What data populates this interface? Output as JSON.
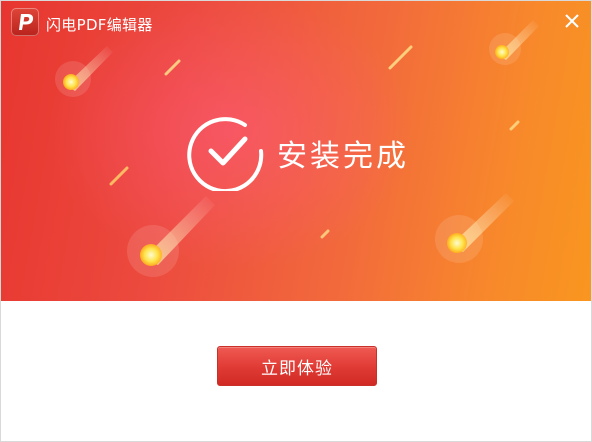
{
  "titlebar": {
    "title": "闪电PDF编辑器",
    "logo_icon": "p-logo-icon",
    "close_icon": "close-icon"
  },
  "hero": {
    "status_text": "安装完成",
    "icon": "check-circle-icon"
  },
  "action": {
    "button_label": "立即体验"
  },
  "colors": {
    "banner_start": "#e7362f",
    "banner_end": "#f9961f",
    "button": "#e03a34"
  }
}
